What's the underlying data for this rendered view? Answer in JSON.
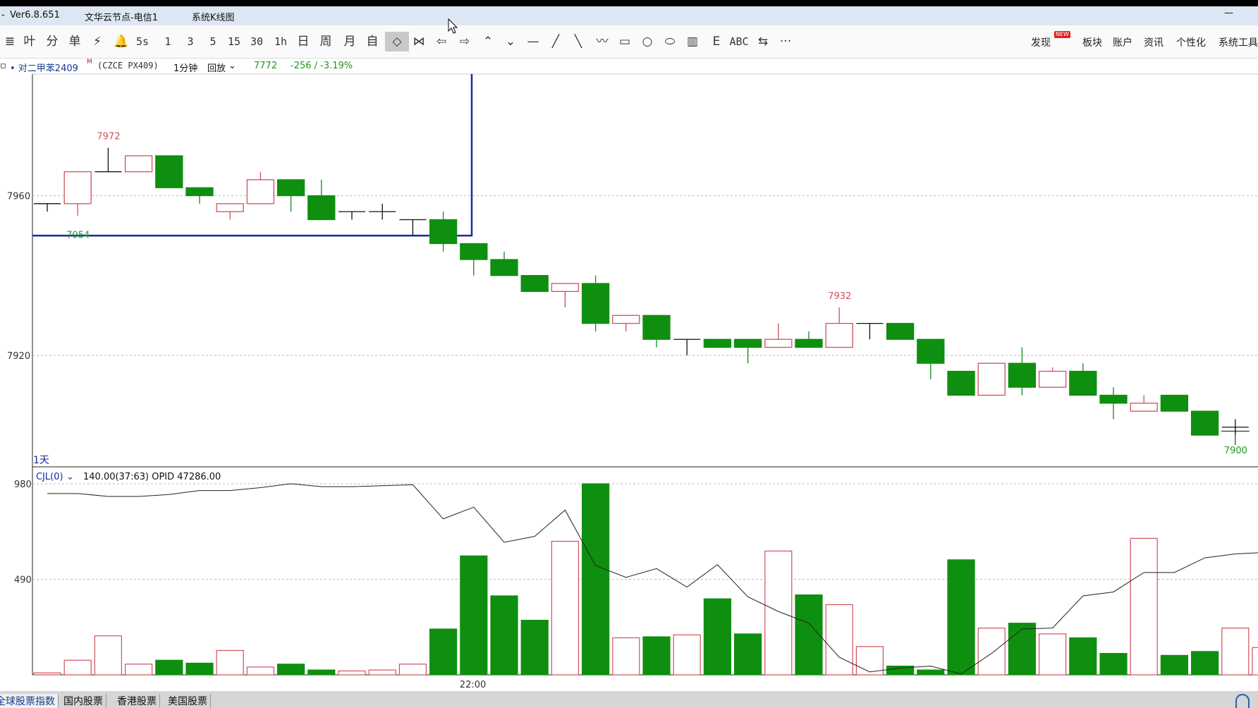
{
  "titlebar": {
    "version": "Ver6.8.651",
    "node": "文华云节点-电信1",
    "view": "系统K线图",
    "minimize": "—"
  },
  "toolbar": {
    "tools": [
      "≣",
      "叶",
      "分",
      "单",
      "⚡",
      "🔔",
      "5s",
      "1",
      "3",
      "5",
      "15",
      "30",
      "1h",
      "日",
      "周",
      "月",
      "自",
      "◇",
      "⋈",
      "⇦",
      "⇨",
      "⌃",
      "⌄",
      "—",
      "╱",
      "╲",
      "〰",
      "▭",
      "○",
      "⬭",
      "▥",
      "E",
      "ABC",
      "⇆",
      "···"
    ],
    "active_index": 17,
    "right_menu": [
      "发现",
      "板块",
      "账户",
      "资讯",
      "个性化",
      "系统工具"
    ],
    "new_badge": "NEW"
  },
  "info": {
    "symbol": "• 对二甲苯2409",
    "superscript": "M",
    "code": "(CZCE PX409)",
    "period": "1分钟",
    "replay": "回放",
    "price": "7772",
    "change": "-256 / -3.19%"
  },
  "chart_data": {
    "type": "candlestick",
    "price_axis": {
      "ticks": [
        7960,
        7920
      ],
      "range": [
        7894,
        7979
      ]
    },
    "volume_axis": {
      "ticks": [
        980,
        490
      ],
      "range": [
        0,
        980
      ]
    },
    "x_tick_labels": [
      {
        "index": 14,
        "label": "22:00"
      }
    ],
    "period_label": "1天",
    "indicator_label": "CJL(0)",
    "indicator_values": "140.00(37:63)  OPID 47286.00",
    "high_marker": 7972,
    "low_marker": 7954,
    "mid_high_marker": 7932,
    "last_low_marker": 7900,
    "candles": [
      {
        "o": 7958,
        "h": 7958,
        "l": 7956,
        "c": 7958
      },
      {
        "o": 7958,
        "h": 7966,
        "l": 7955,
        "c": 7966
      },
      {
        "o": 7966,
        "h": 7972,
        "l": 7966,
        "c": 7966
      },
      {
        "o": 7966,
        "h": 7970,
        "l": 7966,
        "c": 7970
      },
      {
        "o": 7970,
        "h": 7970,
        "l": 7962,
        "c": 7962
      },
      {
        "o": 7962,
        "h": 7962,
        "l": 7958,
        "c": 7960
      },
      {
        "o": 7956,
        "h": 7958,
        "l": 7954,
        "c": 7958
      },
      {
        "o": 7958,
        "h": 7966,
        "l": 7958,
        "c": 7964
      },
      {
        "o": 7964,
        "h": 7964,
        "l": 7956,
        "c": 7960
      },
      {
        "o": 7960,
        "h": 7964,
        "l": 7954,
        "c": 7954
      },
      {
        "o": 7956,
        "h": 7956,
        "l": 7954,
        "c": 7956
      },
      {
        "o": 7956,
        "h": 7958,
        "l": 7954,
        "c": 7956
      },
      {
        "o": 7954,
        "h": 7954,
        "l": 7950,
        "c": 7954
      },
      {
        "o": 7954,
        "h": 7956,
        "l": 7946,
        "c": 7948
      },
      {
        "o": 7948,
        "h": 7948,
        "l": 7940,
        "c": 7944
      },
      {
        "o": 7944,
        "h": 7946,
        "l": 7940,
        "c": 7940
      },
      {
        "o": 7940,
        "h": 7940,
        "l": 7936,
        "c": 7936
      },
      {
        "o": 7936,
        "h": 7936,
        "l": 7932,
        "c": 7938
      },
      {
        "o": 7938,
        "h": 7940,
        "l": 7926,
        "c": 7928
      },
      {
        "o": 7928,
        "h": 7930,
        "l": 7926,
        "c": 7930
      },
      {
        "o": 7930,
        "h": 7930,
        "l": 7922,
        "c": 7924
      },
      {
        "o": 7924,
        "h": 7924,
        "l": 7920,
        "c": 7924
      },
      {
        "o": 7924,
        "h": 7924,
        "l": 7922,
        "c": 7922
      },
      {
        "o": 7924,
        "h": 7924,
        "l": 7918,
        "c": 7922
      },
      {
        "o": 7922,
        "h": 7928,
        "l": 7922,
        "c": 7924
      },
      {
        "o": 7924,
        "h": 7926,
        "l": 7922,
        "c": 7922
      },
      {
        "o": 7922,
        "h": 7932,
        "l": 7922,
        "c": 7928
      },
      {
        "o": 7928,
        "h": 7928,
        "l": 7924,
        "c": 7928
      },
      {
        "o": 7928,
        "h": 7928,
        "l": 7924,
        "c": 7924
      },
      {
        "o": 7924,
        "h": 7924,
        "l": 7914,
        "c": 7918
      },
      {
        "o": 7916,
        "h": 7916,
        "l": 7910,
        "c": 7910
      },
      {
        "o": 7910,
        "h": 7918,
        "l": 7910,
        "c": 7918
      },
      {
        "o": 7918,
        "h": 7922,
        "l": 7910,
        "c": 7912
      },
      {
        "o": 7912,
        "h": 7917,
        "l": 7912,
        "c": 7916
      },
      {
        "o": 7916,
        "h": 7918,
        "l": 7910,
        "c": 7910
      },
      {
        "o": 7910,
        "h": 7912,
        "l": 7904,
        "c": 7908
      },
      {
        "o": 7906,
        "h": 7910,
        "l": 7906,
        "c": 7908
      },
      {
        "o": 7910,
        "h": 7910,
        "l": 7906,
        "c": 7906
      },
      {
        "o": 7906,
        "h": 7906,
        "l": 7900,
        "c": 7900
      },
      {
        "o": 7902,
        "h": 7904,
        "l": 7900,
        "c": 7902
      }
    ],
    "volume": [
      10,
      75,
      200,
      55,
      75,
      60,
      125,
      40,
      55,
      25,
      20,
      25,
      55,
      235,
      610,
      405,
      280,
      685,
      980,
      190,
      195,
      205,
      390,
      210,
      635,
      410,
      360,
      145,
      45,
      25,
      590,
      240,
      265,
      210,
      190,
      110,
      700,
      100,
      120,
      240,
      140
    ],
    "opid_line": [
      930,
      930,
      915,
      915,
      925,
      945,
      945,
      960,
      980,
      965,
      965,
      970,
      975,
      800,
      860,
      680,
      710,
      845,
      560,
      500,
      545,
      450,
      565,
      400,
      325,
      265,
      90,
      15,
      35,
      45,
      5,
      110,
      235,
      240,
      405,
      425,
      525,
      525,
      600,
      620,
      628
    ]
  },
  "tabs": [
    "全球股票指数",
    "国内股票",
    "香港股票",
    "美国股票"
  ]
}
